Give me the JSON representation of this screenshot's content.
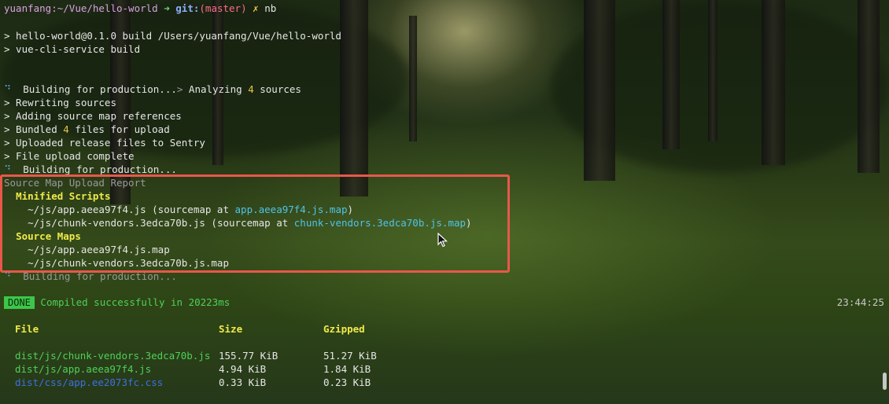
{
  "prompt": {
    "user": "yuanfang",
    "path": "~/Vue/hello-world",
    "arrow": "➜",
    "git_label": "git:",
    "branch": "(master)",
    "x_mark": "✗",
    "command": "nb"
  },
  "build": {
    "line1": "> hello-world@0.1.0 build /Users/yuanfang/Vue/hello-world",
    "line2": "> vue-cli-service build"
  },
  "progress": {
    "spinner": "⠙",
    "building": "  Building for production...",
    "analyzing_prefix": " Analyzing ",
    "analyzing_count": "4",
    "analyzing_suffix": " sources",
    "steps": [
      "> Rewriting sources",
      "> Adding source map references"
    ],
    "bundled_prefix": "> Bundled ",
    "bundled_count": "4",
    "bundled_suffix": " files for upload",
    "steps2": [
      "> Uploaded release files to Sentry",
      "> File upload complete"
    ],
    "building_again": "  Building for production..."
  },
  "report": {
    "title": "Source Map Upload Report",
    "minified_heading": "Minified Scripts",
    "scripts": [
      {
        "file": "~/js/app.aeea97f4.js",
        "pre": " (sourcemap at ",
        "map": "app.aeea97f4.js.map",
        "post": ")"
      },
      {
        "file": "~/js/chunk-vendors.3edca70b.js",
        "pre": " (sourcemap at ",
        "map": "chunk-vendors.3edca70b.js.map",
        "post": ")"
      }
    ],
    "maps_heading": "Source Maps",
    "maps": [
      "~/js/app.aeea97f4.js.map",
      "~/js/chunk-vendors.3edca70b.js.map"
    ],
    "building_tail": "  Building for production..."
  },
  "result": {
    "badge": "DONE",
    "message": " Compiled successfully in 20223ms",
    "time": "23:44:25"
  },
  "table": {
    "headers": [
      "File",
      "Size",
      "Gzipped"
    ],
    "rows": [
      {
        "file": "dist/js/chunk-vendors.3edca70b.js",
        "size": "155.77 KiB",
        "gzip": "51.27 KiB"
      },
      {
        "file": "dist/js/app.aeea97f4.js",
        "size": "4.94 KiB",
        "gzip": "1.84 KiB"
      },
      {
        "file": "dist/css/app.ee2073fc.css",
        "size": "0.33 KiB",
        "gzip": "0.23 KiB"
      }
    ]
  },
  "colors": {
    "highlight_box": "#e8584a",
    "done_badge": "#3cc64a"
  }
}
